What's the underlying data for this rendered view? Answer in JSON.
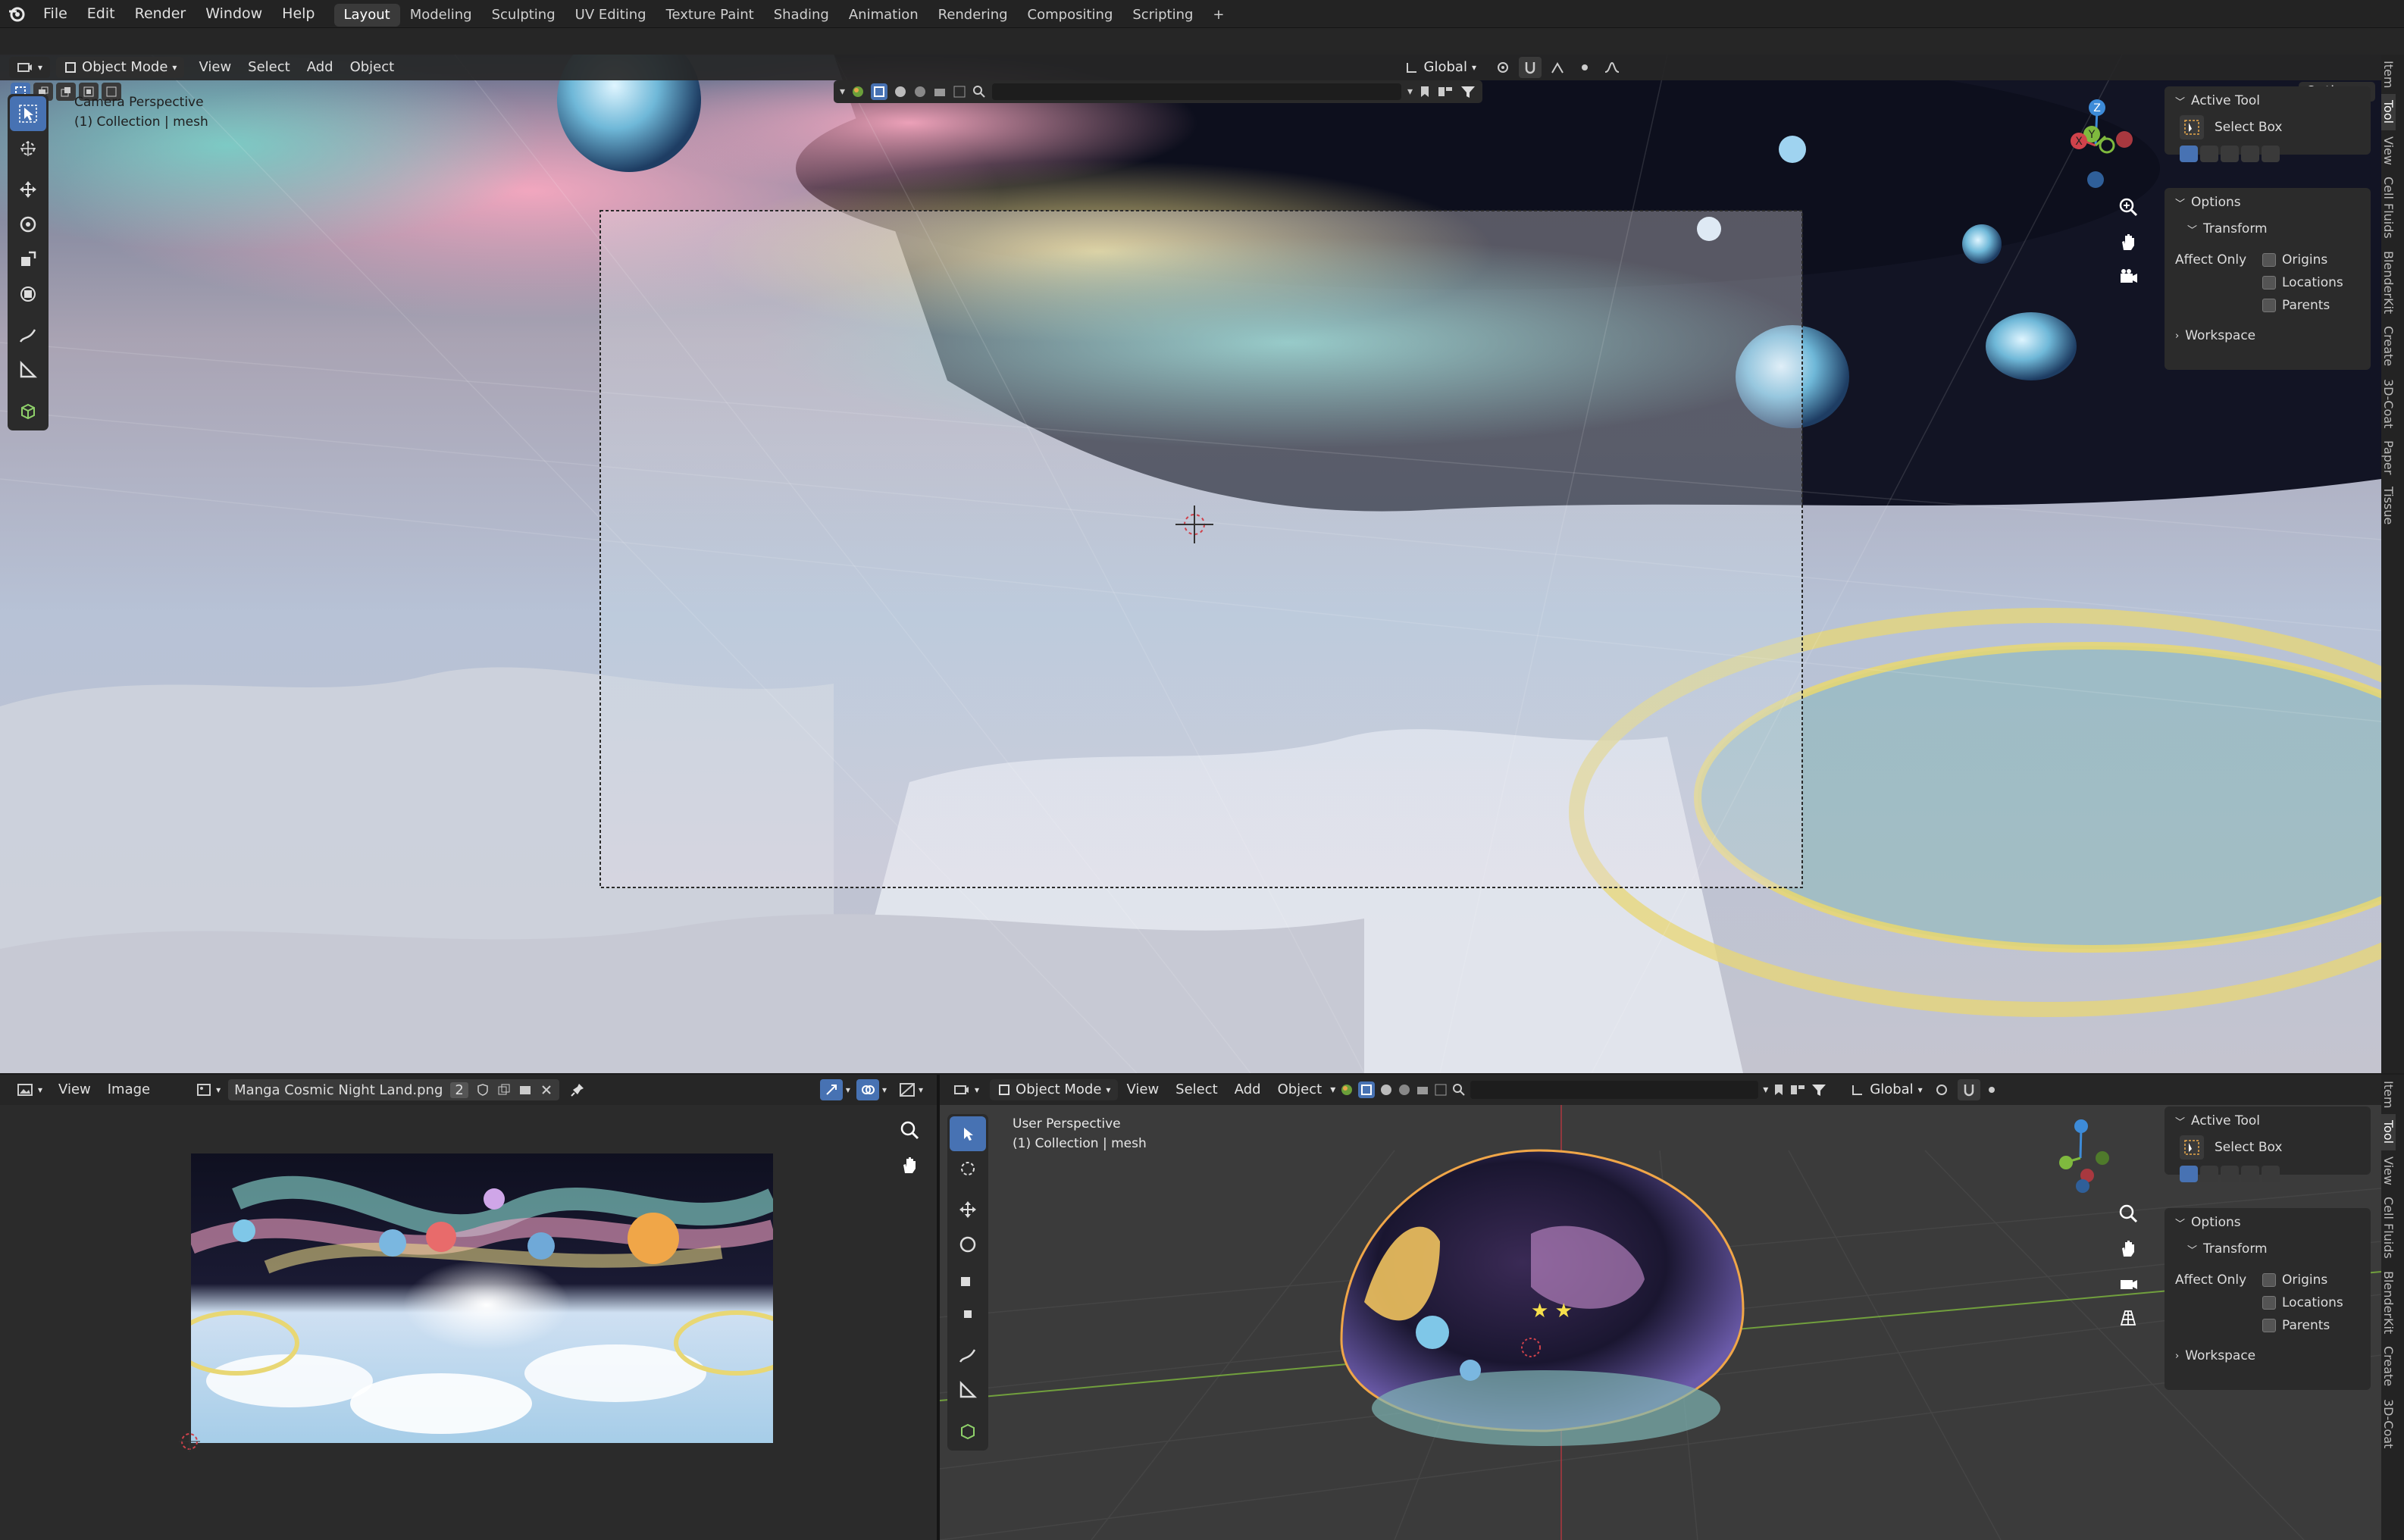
{
  "menus": [
    "File",
    "Edit",
    "Render",
    "Window",
    "Help"
  ],
  "workspaces": [
    "Layout",
    "Modeling",
    "Sculpting",
    "UV Editing",
    "Texture Paint",
    "Shading",
    "Animation",
    "Rendering",
    "Compositing",
    "Scripting"
  ],
  "workspace_add": "+",
  "top_viewport": {
    "mode": "Object Mode",
    "menus": [
      "View",
      "Select",
      "Add",
      "Object"
    ],
    "orientation": "Global",
    "options_label": "Options",
    "camera_label": "Camera Perspective",
    "collection_label": "(1) Collection | mesh",
    "axes": {
      "z": "Z",
      "y": "Y",
      "x": "X"
    }
  },
  "n_panel": {
    "active_tool": "Active Tool",
    "select_box": "Select Box",
    "options": "Options",
    "transform": "Transform",
    "affect_only": "Affect Only",
    "origins": "Origins",
    "locations": "Locations",
    "parents": "Parents",
    "workspace": "Workspace"
  },
  "side_tabs_top": [
    "Item",
    "Tool",
    "View",
    "Cell Fluids",
    "BlenderKit",
    "Create",
    "3D-Coat",
    "Paper",
    "Tissue"
  ],
  "side_tabs_bottom": [
    "Item",
    "Tool",
    "View",
    "Cell Fluids",
    "BlenderKit",
    "Create",
    "3D-Coat"
  ],
  "image_editor": {
    "menus": [
      "View",
      "Image"
    ],
    "image_name": "Manga Cosmic Night Land.png",
    "users": "2"
  },
  "bottom_viewport": {
    "mode": "Object Mode",
    "menus": [
      "View",
      "Select",
      "Add",
      "Object"
    ],
    "orientation": "Global",
    "user_label": "User Perspective",
    "collection_label": "(1) Collection | mesh"
  },
  "colors": {
    "accent": "#4772b3",
    "panel": "#2b2b2b",
    "bg": "#1d1d1d",
    "axis_x": "#d0424b",
    "axis_y": "#7fb93e",
    "axis_z": "#3d8bd8"
  }
}
